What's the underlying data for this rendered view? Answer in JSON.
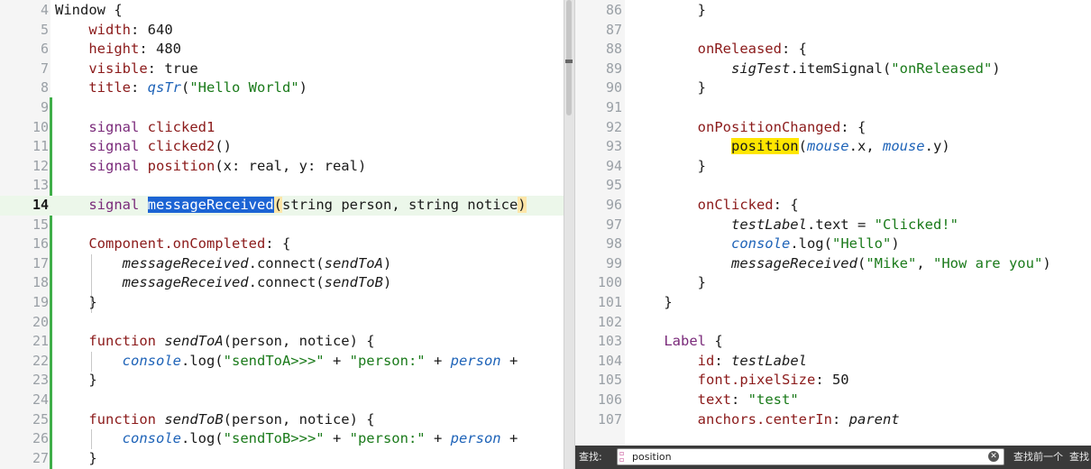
{
  "left_editor": {
    "lines": [
      {
        "n": "4",
        "tokens": [
          {
            "t": "Window {"
          }
        ]
      },
      {
        "n": "5",
        "tokens": [
          {
            "t": "    "
          },
          {
            "t": "width",
            "c": "kw"
          },
          {
            "t": ": 640"
          }
        ]
      },
      {
        "n": "6",
        "tokens": [
          {
            "t": "    "
          },
          {
            "t": "height",
            "c": "kw"
          },
          {
            "t": ": 480"
          }
        ]
      },
      {
        "n": "7",
        "tokens": [
          {
            "t": "    "
          },
          {
            "t": "visible",
            "c": "kw"
          },
          {
            "t": ": true"
          }
        ]
      },
      {
        "n": "8",
        "tokens": [
          {
            "t": "    "
          },
          {
            "t": "title",
            "c": "kw"
          },
          {
            "t": ": "
          },
          {
            "t": "qsTr",
            "c": "blue"
          },
          {
            "t": "("
          },
          {
            "t": "\"Hello World\"",
            "c": "str"
          },
          {
            "t": ")"
          }
        ]
      },
      {
        "n": "9",
        "tokens": []
      },
      {
        "n": "10",
        "tokens": [
          {
            "t": "    "
          },
          {
            "t": "signal",
            "c": "type"
          },
          {
            "t": " "
          },
          {
            "t": "clicked1",
            "c": "kw"
          }
        ]
      },
      {
        "n": "11",
        "tokens": [
          {
            "t": "    "
          },
          {
            "t": "signal",
            "c": "type"
          },
          {
            "t": " "
          },
          {
            "t": "clicked2",
            "c": "kw"
          },
          {
            "t": "()"
          }
        ]
      },
      {
        "n": "12",
        "tokens": [
          {
            "t": "    "
          },
          {
            "t": "signal",
            "c": "type"
          },
          {
            "t": " "
          },
          {
            "t": "position",
            "c": "kw"
          },
          {
            "t": "(x: real, y: real)"
          }
        ]
      },
      {
        "n": "13",
        "tokens": []
      },
      {
        "n": "14",
        "current": true,
        "tokens": [
          {
            "t": "    "
          },
          {
            "t": "signal",
            "c": "type"
          },
          {
            "t": " "
          },
          {
            "t": "messageReceived",
            "c": "sel"
          },
          {
            "t": "(",
            "c": "paren"
          },
          {
            "t": "string person, string notice"
          },
          {
            "t": ")",
            "c": "paren"
          }
        ]
      },
      {
        "n": "15",
        "tokens": []
      },
      {
        "n": "16",
        "tokens": [
          {
            "t": "    "
          },
          {
            "t": "Component.onCompleted",
            "c": "kw"
          },
          {
            "t": ": {"
          }
        ]
      },
      {
        "n": "17",
        "tokens": [
          {
            "t": "        "
          },
          {
            "t": "messageReceived",
            "c": "it"
          },
          {
            "t": ".connect("
          },
          {
            "t": "sendToA",
            "c": "it"
          },
          {
            "t": ")"
          }
        ]
      },
      {
        "n": "18",
        "tokens": [
          {
            "t": "        "
          },
          {
            "t": "messageReceived",
            "c": "it"
          },
          {
            "t": ".connect("
          },
          {
            "t": "sendToB",
            "c": "it"
          },
          {
            "t": ")"
          }
        ]
      },
      {
        "n": "19",
        "tokens": [
          {
            "t": "    }"
          }
        ]
      },
      {
        "n": "20",
        "tokens": []
      },
      {
        "n": "21",
        "tokens": [
          {
            "t": "    "
          },
          {
            "t": "function",
            "c": "kw"
          },
          {
            "t": " "
          },
          {
            "t": "sendToA",
            "c": "it"
          },
          {
            "t": "(person, notice) {"
          }
        ]
      },
      {
        "n": "22",
        "tokens": [
          {
            "t": "        "
          },
          {
            "t": "console",
            "c": "blue"
          },
          {
            "t": ".log("
          },
          {
            "t": "\"sendToA>>>\"",
            "c": "str"
          },
          {
            "t": " + "
          },
          {
            "t": "\"person:\"",
            "c": "str"
          },
          {
            "t": " + "
          },
          {
            "t": "person",
            "c": "blue"
          },
          {
            "t": " +"
          }
        ]
      },
      {
        "n": "23",
        "tokens": [
          {
            "t": "    }"
          }
        ]
      },
      {
        "n": "24",
        "tokens": []
      },
      {
        "n": "25",
        "tokens": [
          {
            "t": "    "
          },
          {
            "t": "function",
            "c": "kw"
          },
          {
            "t": " "
          },
          {
            "t": "sendToB",
            "c": "it"
          },
          {
            "t": "(person, notice) {"
          }
        ]
      },
      {
        "n": "26",
        "tokens": [
          {
            "t": "        "
          },
          {
            "t": "console",
            "c": "blue"
          },
          {
            "t": ".log("
          },
          {
            "t": "\"sendToB>>>\"",
            "c": "str"
          },
          {
            "t": " + "
          },
          {
            "t": "\"person:\"",
            "c": "str"
          },
          {
            "t": " + "
          },
          {
            "t": "person",
            "c": "blue"
          },
          {
            "t": " +"
          }
        ]
      },
      {
        "n": "27",
        "tokens": [
          {
            "t": "    }"
          }
        ]
      }
    ]
  },
  "right_editor": {
    "lines": [
      {
        "n": "86",
        "tokens": [
          {
            "t": "        }"
          }
        ]
      },
      {
        "n": "87",
        "tokens": []
      },
      {
        "n": "88",
        "tokens": [
          {
            "t": "        "
          },
          {
            "t": "onReleased",
            "c": "kw"
          },
          {
            "t": ": {"
          }
        ]
      },
      {
        "n": "89",
        "tokens": [
          {
            "t": "            "
          },
          {
            "t": "sigTest",
            "c": "it"
          },
          {
            "t": ".itemSignal("
          },
          {
            "t": "\"onReleased\"",
            "c": "str"
          },
          {
            "t": ")"
          }
        ]
      },
      {
        "n": "90",
        "tokens": [
          {
            "t": "        }"
          }
        ]
      },
      {
        "n": "91",
        "tokens": []
      },
      {
        "n": "92",
        "tokens": [
          {
            "t": "        "
          },
          {
            "t": "onPositionChanged",
            "c": "kw"
          },
          {
            "t": ": {"
          }
        ]
      },
      {
        "n": "93",
        "tokens": [
          {
            "t": "            "
          },
          {
            "t": "position",
            "c": "hl"
          },
          {
            "t": "("
          },
          {
            "t": "mouse",
            "c": "blue"
          },
          {
            "t": ".x, "
          },
          {
            "t": "mouse",
            "c": "blue"
          },
          {
            "t": ".y)"
          }
        ]
      },
      {
        "n": "94",
        "tokens": [
          {
            "t": "        }"
          }
        ]
      },
      {
        "n": "95",
        "tokens": []
      },
      {
        "n": "96",
        "tokens": [
          {
            "t": "        "
          },
          {
            "t": "onClicked",
            "c": "kw"
          },
          {
            "t": ": {"
          }
        ]
      },
      {
        "n": "97",
        "tokens": [
          {
            "t": "            "
          },
          {
            "t": "testLabel",
            "c": "it"
          },
          {
            "t": ".text = "
          },
          {
            "t": "\"Clicked!\"",
            "c": "str"
          }
        ]
      },
      {
        "n": "98",
        "tokens": [
          {
            "t": "            "
          },
          {
            "t": "console",
            "c": "blue"
          },
          {
            "t": ".log("
          },
          {
            "t": "\"Hello\"",
            "c": "str"
          },
          {
            "t": ")"
          }
        ]
      },
      {
        "n": "99",
        "tokens": [
          {
            "t": "            "
          },
          {
            "t": "messageReceived",
            "c": "it"
          },
          {
            "t": "("
          },
          {
            "t": "\"Mike\"",
            "c": "str"
          },
          {
            "t": ", "
          },
          {
            "t": "\"How are you\"",
            "c": "str"
          },
          {
            "t": ")"
          }
        ]
      },
      {
        "n": "100",
        "tokens": [
          {
            "t": "        }"
          }
        ]
      },
      {
        "n": "101",
        "tokens": [
          {
            "t": "    }"
          }
        ]
      },
      {
        "n": "102",
        "tokens": []
      },
      {
        "n": "103",
        "tokens": [
          {
            "t": "    "
          },
          {
            "t": "Label",
            "c": "type"
          },
          {
            "t": " {"
          }
        ]
      },
      {
        "n": "104",
        "tokens": [
          {
            "t": "        "
          },
          {
            "t": "id",
            "c": "kw"
          },
          {
            "t": ": "
          },
          {
            "t": "testLabel",
            "c": "it"
          }
        ]
      },
      {
        "n": "105",
        "tokens": [
          {
            "t": "        "
          },
          {
            "t": "font.pixelSize",
            "c": "kw"
          },
          {
            "t": ": 50"
          }
        ]
      },
      {
        "n": "106",
        "tokens": [
          {
            "t": "        "
          },
          {
            "t": "text",
            "c": "kw"
          },
          {
            "t": ": "
          },
          {
            "t": "\"test\"",
            "c": "str"
          }
        ]
      },
      {
        "n": "107",
        "tokens": [
          {
            "t": "        "
          },
          {
            "t": "anchors.centerIn",
            "c": "kw"
          },
          {
            "t": ": "
          },
          {
            "t": "parent",
            "c": "it"
          }
        ]
      }
    ]
  },
  "find_bar": {
    "label": "查找:",
    "value": "position",
    "prev_label": "查找前一个",
    "next_label": "查找"
  },
  "icons": {
    "find_options": "find-options-icon",
    "clear": "clear-icon"
  },
  "colors": {
    "keyword": "#8b1a1a",
    "type": "#7a2a7a",
    "string": "#1a7a1a",
    "identifier_blue": "#1e63b8",
    "selection": "#1c64d4",
    "search_highlight": "#ffe600",
    "modified_bar": "#3fae49"
  }
}
